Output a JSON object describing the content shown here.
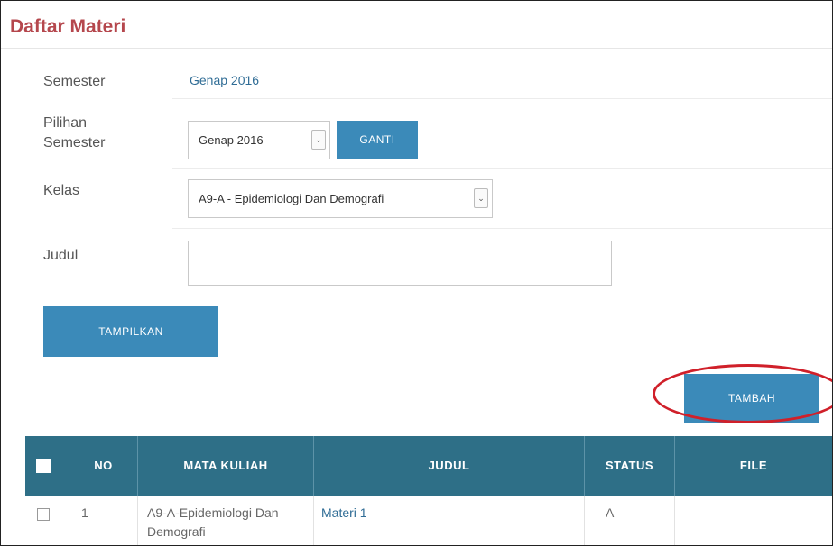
{
  "page": {
    "title": "Daftar Materi"
  },
  "form": {
    "semester": {
      "label": "Semester",
      "value": "Genap 2016"
    },
    "pilihan_semester": {
      "label_line1": "Pilihan",
      "label_line2": "Semester",
      "selected": "Genap 2016",
      "button": "GANTI"
    },
    "kelas": {
      "label": "Kelas",
      "selected": "A9-A - Epidemiologi Dan Demografi"
    },
    "judul": {
      "label": "Judul",
      "value": ""
    },
    "tampilkan_button": "TAMPILKAN",
    "tambah_button": "TAMBAH"
  },
  "table": {
    "headers": [
      "NO",
      "MATA KULIAH",
      "JUDUL",
      "STATUS",
      "FILE"
    ],
    "rows": [
      {
        "no": "1",
        "mata_kuliah_line1": "A9-A-Epidemiologi Dan",
        "mata_kuliah_line2": "Demografi",
        "judul": "Materi 1",
        "status": "A",
        "file": ""
      }
    ]
  },
  "icons": {
    "dropdown_caret": "⌄"
  },
  "colors": {
    "title": "#b5474d",
    "button": "#3b8ab9",
    "table_header": "#2e6f87",
    "highlight": "#d0202a",
    "value_text": "#2f6c95"
  }
}
